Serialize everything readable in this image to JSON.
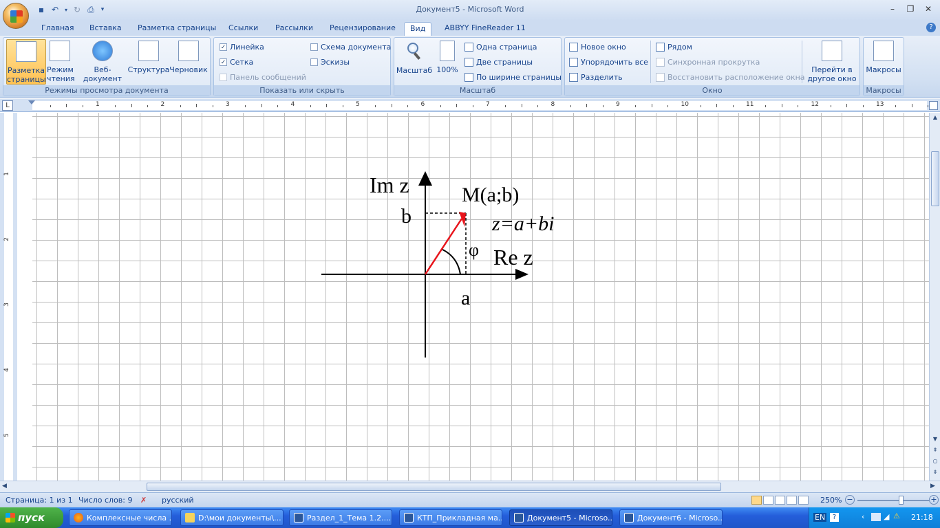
{
  "window": {
    "title": "Документ5 - Microsoft Word",
    "minimize": "–",
    "maximize": "❐",
    "close": "✕"
  },
  "tabs": [
    "Главная",
    "Вставка",
    "Разметка страницы",
    "Ссылки",
    "Рассылки",
    "Рецензирование",
    "Вид",
    "ABBYY FineReader 11"
  ],
  "active_tab": "Вид",
  "ribbon": {
    "views": {
      "label": "Режимы просмотра документа",
      "buttons": [
        "Разметка страницы",
        "Режим чтения",
        "Веб-документ",
        "Структура",
        "Черновик"
      ]
    },
    "show": {
      "label": "Показать или скрыть",
      "ruler": "Линейка",
      "grid": "Сетка",
      "messages": "Панель сообщений",
      "docmap": "Схема документа",
      "thumbs": "Эскизы",
      "checked_mark": "✓"
    },
    "zoom": {
      "label": "Масштаб",
      "zoom_btn": "Масштаб",
      "hundred": "100%",
      "one_page": "Одна страница",
      "two_pages": "Две страницы",
      "page_width": "По ширине страницы"
    },
    "window": {
      "label": "Окно",
      "new_window": "Новое окно",
      "arrange_all": "Упорядочить все",
      "split": "Разделить",
      "side_by_side": "Рядом",
      "sync_scroll": "Синхронная прокрутка",
      "reset_pos": "Восстановить расположение окна",
      "switch": "Перейти в другое окно"
    },
    "macros": {
      "label": "Макросы",
      "button": "Макросы"
    }
  },
  "ruler": {
    "tab_selector": "L",
    "h_numbers": [
      "1",
      "2",
      "3",
      "4",
      "5",
      "6",
      "7",
      "8",
      "9",
      "10",
      "11",
      "12",
      "13"
    ],
    "v_numbers": [
      "1",
      "2",
      "3",
      "4",
      "5"
    ]
  },
  "diagram": {
    "im_label": "Im z",
    "re_label": "Re z",
    "point_label": "M(a;b)",
    "formula": "z=a+bi",
    "b_label": "b",
    "a_label": "a",
    "phi_label": "φ",
    "vector_color": "#e8141b"
  },
  "status": {
    "page": "Страница: 1 из 1",
    "words": "Число слов: 9",
    "language": "русский",
    "zoom": "250%"
  },
  "taskbar": {
    "start": "пуск",
    "items": [
      "Комплексные числа ...",
      "D:\\мои документы\\...",
      "Раздел_1_Тема 1.2....",
      "КТП_Прикладная ма...",
      "Документ5 - Microso...",
      "Документ6 - Microso..."
    ],
    "active_index": 4,
    "lang": "EN",
    "clock": "21:18"
  }
}
